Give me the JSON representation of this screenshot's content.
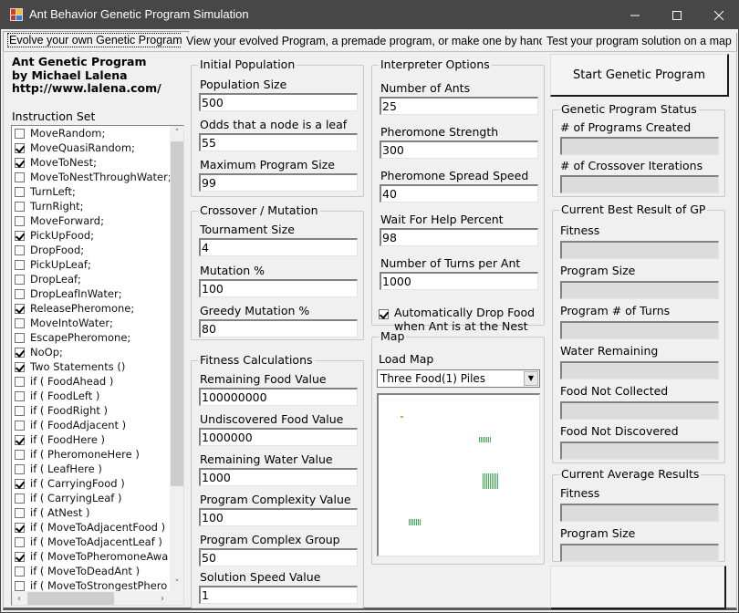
{
  "window": {
    "title": "Ant Behavior Genetic Program Simulation",
    "icon": "app-icon",
    "controls": [
      "minimize-icon",
      "maximize-icon",
      "close-icon"
    ]
  },
  "tabs": [
    {
      "label": "Evolve your own Genetic Program",
      "active": true
    },
    {
      "label": "View your evolved Program, a premade program, or make one by hand",
      "active": false
    },
    {
      "label": "Test your program solution on a map",
      "active": false
    }
  ],
  "author": {
    "line1": "Ant Genetic Program",
    "line2": "by Michael Lalena",
    "line3": "http://www.lalena.com/"
  },
  "instruction_set": {
    "label": "Instruction Set",
    "items": [
      {
        "label": "MoveRandom;",
        "checked": false
      },
      {
        "label": "MoveQuasiRandom;",
        "checked": true
      },
      {
        "label": "MoveToNest;",
        "checked": true
      },
      {
        "label": "MoveToNestThroughWater;",
        "checked": false
      },
      {
        "label": "TurnLeft;",
        "checked": false
      },
      {
        "label": "TurnRight;",
        "checked": false
      },
      {
        "label": "MoveForward;",
        "checked": false
      },
      {
        "label": "PickUpFood;",
        "checked": true
      },
      {
        "label": "DropFood;",
        "checked": false
      },
      {
        "label": "PickUpLeaf;",
        "checked": false
      },
      {
        "label": "DropLeaf;",
        "checked": false
      },
      {
        "label": "DropLeafInWater;",
        "checked": false
      },
      {
        "label": "ReleasePheromone;",
        "checked": true
      },
      {
        "label": "MoveIntoWater;",
        "checked": false
      },
      {
        "label": "EscapePheromone;",
        "checked": false
      },
      {
        "label": "NoOp;",
        "checked": true
      },
      {
        "label": "Two Statements ()",
        "checked": true
      },
      {
        "label": "if ( FoodAhead )",
        "checked": false
      },
      {
        "label": "if ( FoodLeft )",
        "checked": false
      },
      {
        "label": "if ( FoodRight )",
        "checked": false
      },
      {
        "label": "if ( FoodAdjacent )",
        "checked": false
      },
      {
        "label": "if ( FoodHere )",
        "checked": true
      },
      {
        "label": "if ( PheromoneHere )",
        "checked": false
      },
      {
        "label": "if ( LeafHere )",
        "checked": false
      },
      {
        "label": "if ( CarryingFood )",
        "checked": true
      },
      {
        "label": "if ( CarryingLeaf )",
        "checked": false
      },
      {
        "label": "if ( AtNest )",
        "checked": false
      },
      {
        "label": "if ( MoveToAdjacentFood )",
        "checked": true
      },
      {
        "label": "if ( MoveToAdjacentLeaf )",
        "checked": false
      },
      {
        "label": "if ( MoveToPheromoneAwa",
        "checked": true
      },
      {
        "label": "if ( MoveToDeadAnt )",
        "checked": false
      },
      {
        "label": "if ( MoveToStrongestPhero",
        "checked": false
      }
    ]
  },
  "initial_population": {
    "title": "Initial Population",
    "fields": [
      {
        "label": "Population Size",
        "value": "500"
      },
      {
        "label": "Odds that a node is a leaf",
        "value": "55"
      },
      {
        "label": "Maximum Program Size",
        "value": "99"
      }
    ]
  },
  "crossover_mutation": {
    "title": "Crossover / Mutation",
    "fields": [
      {
        "label": "Tournament Size",
        "value": "4"
      },
      {
        "label": "Mutation %",
        "value": "100"
      },
      {
        "label": "Greedy Mutation %",
        "value": "80"
      }
    ]
  },
  "fitness_calculations": {
    "title": "Fitness Calculations",
    "fields": [
      {
        "label": "Remaining Food Value",
        "value": "100000000"
      },
      {
        "label": "Undiscovered Food Value",
        "value": "1000000"
      },
      {
        "label": "Remaining Water Value",
        "value": "1000"
      },
      {
        "label": "Program Complexity Value",
        "value": "100"
      },
      {
        "label": "Program Complex Group",
        "value": "50"
      },
      {
        "label": "Solution Speed Value",
        "value": "1"
      }
    ]
  },
  "interpreter_options": {
    "title": "Interpreter Options",
    "fields": [
      {
        "label": "Number of Ants",
        "value": "25"
      },
      {
        "label": "Pheromone Strength",
        "value": "300"
      },
      {
        "label": "Pheromone Spread Speed",
        "value": "40"
      },
      {
        "label": "Wait For Help Percent",
        "value": "98"
      },
      {
        "label": "Number of Turns per Ant",
        "value": "1000"
      }
    ],
    "auto_drop": {
      "label_line1": "Automatically Drop Food",
      "label_line2": "when Ant is at the Nest",
      "checked": true
    }
  },
  "map": {
    "title": "Map",
    "load_label": "Load Map",
    "selected": "Three Food(1) Piles"
  },
  "start_button": "Start Genetic Program",
  "gp_status": {
    "title": "Genetic Program Status",
    "fields": [
      {
        "label": "# of Programs Created",
        "value": ""
      },
      {
        "label": "# of Crossover Iterations",
        "value": ""
      }
    ]
  },
  "best_result": {
    "title": "Current Best Result of GP",
    "fields": [
      {
        "label": "Fitness",
        "value": ""
      },
      {
        "label": "Program Size",
        "value": ""
      },
      {
        "label": "Program # of Turns",
        "value": ""
      },
      {
        "label": "Water Remaining",
        "value": ""
      },
      {
        "label": "Food Not Collected",
        "value": ""
      },
      {
        "label": "Food Not Discovered",
        "value": ""
      }
    ]
  },
  "average_results": {
    "title": "Current Average Results",
    "fields": [
      {
        "label": "Fitness",
        "value": ""
      },
      {
        "label": "Program Size",
        "value": ""
      }
    ]
  },
  "bottom_button": ""
}
